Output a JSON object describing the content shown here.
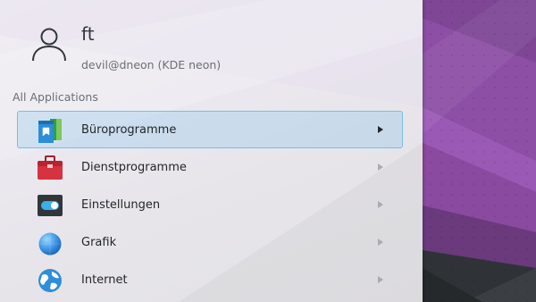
{
  "user": {
    "name": "ft",
    "host": "devil@dneon (KDE neon)",
    "avatar_icon": "user-icon"
  },
  "section": {
    "label": "All Applications"
  },
  "apps": [
    {
      "label": "Büroprogramme",
      "icon": "office-document-icon",
      "selected": true
    },
    {
      "label": "Dienstprogramme",
      "icon": "toolbox-icon",
      "selected": false
    },
    {
      "label": "Einstellungen",
      "icon": "settings-toggle-icon",
      "selected": false
    },
    {
      "label": "Grafik",
      "icon": "graphics-sphere-icon",
      "selected": false
    },
    {
      "label": "Internet",
      "icon": "globe-icon",
      "selected": false
    }
  ],
  "colors": {
    "selection_bg": "#d3e6f3",
    "selection_border": "#7bbde6",
    "wallpaper_purple": "#8b4aa3",
    "text_primary": "#232629",
    "text_secondary": "#6b6f74"
  }
}
